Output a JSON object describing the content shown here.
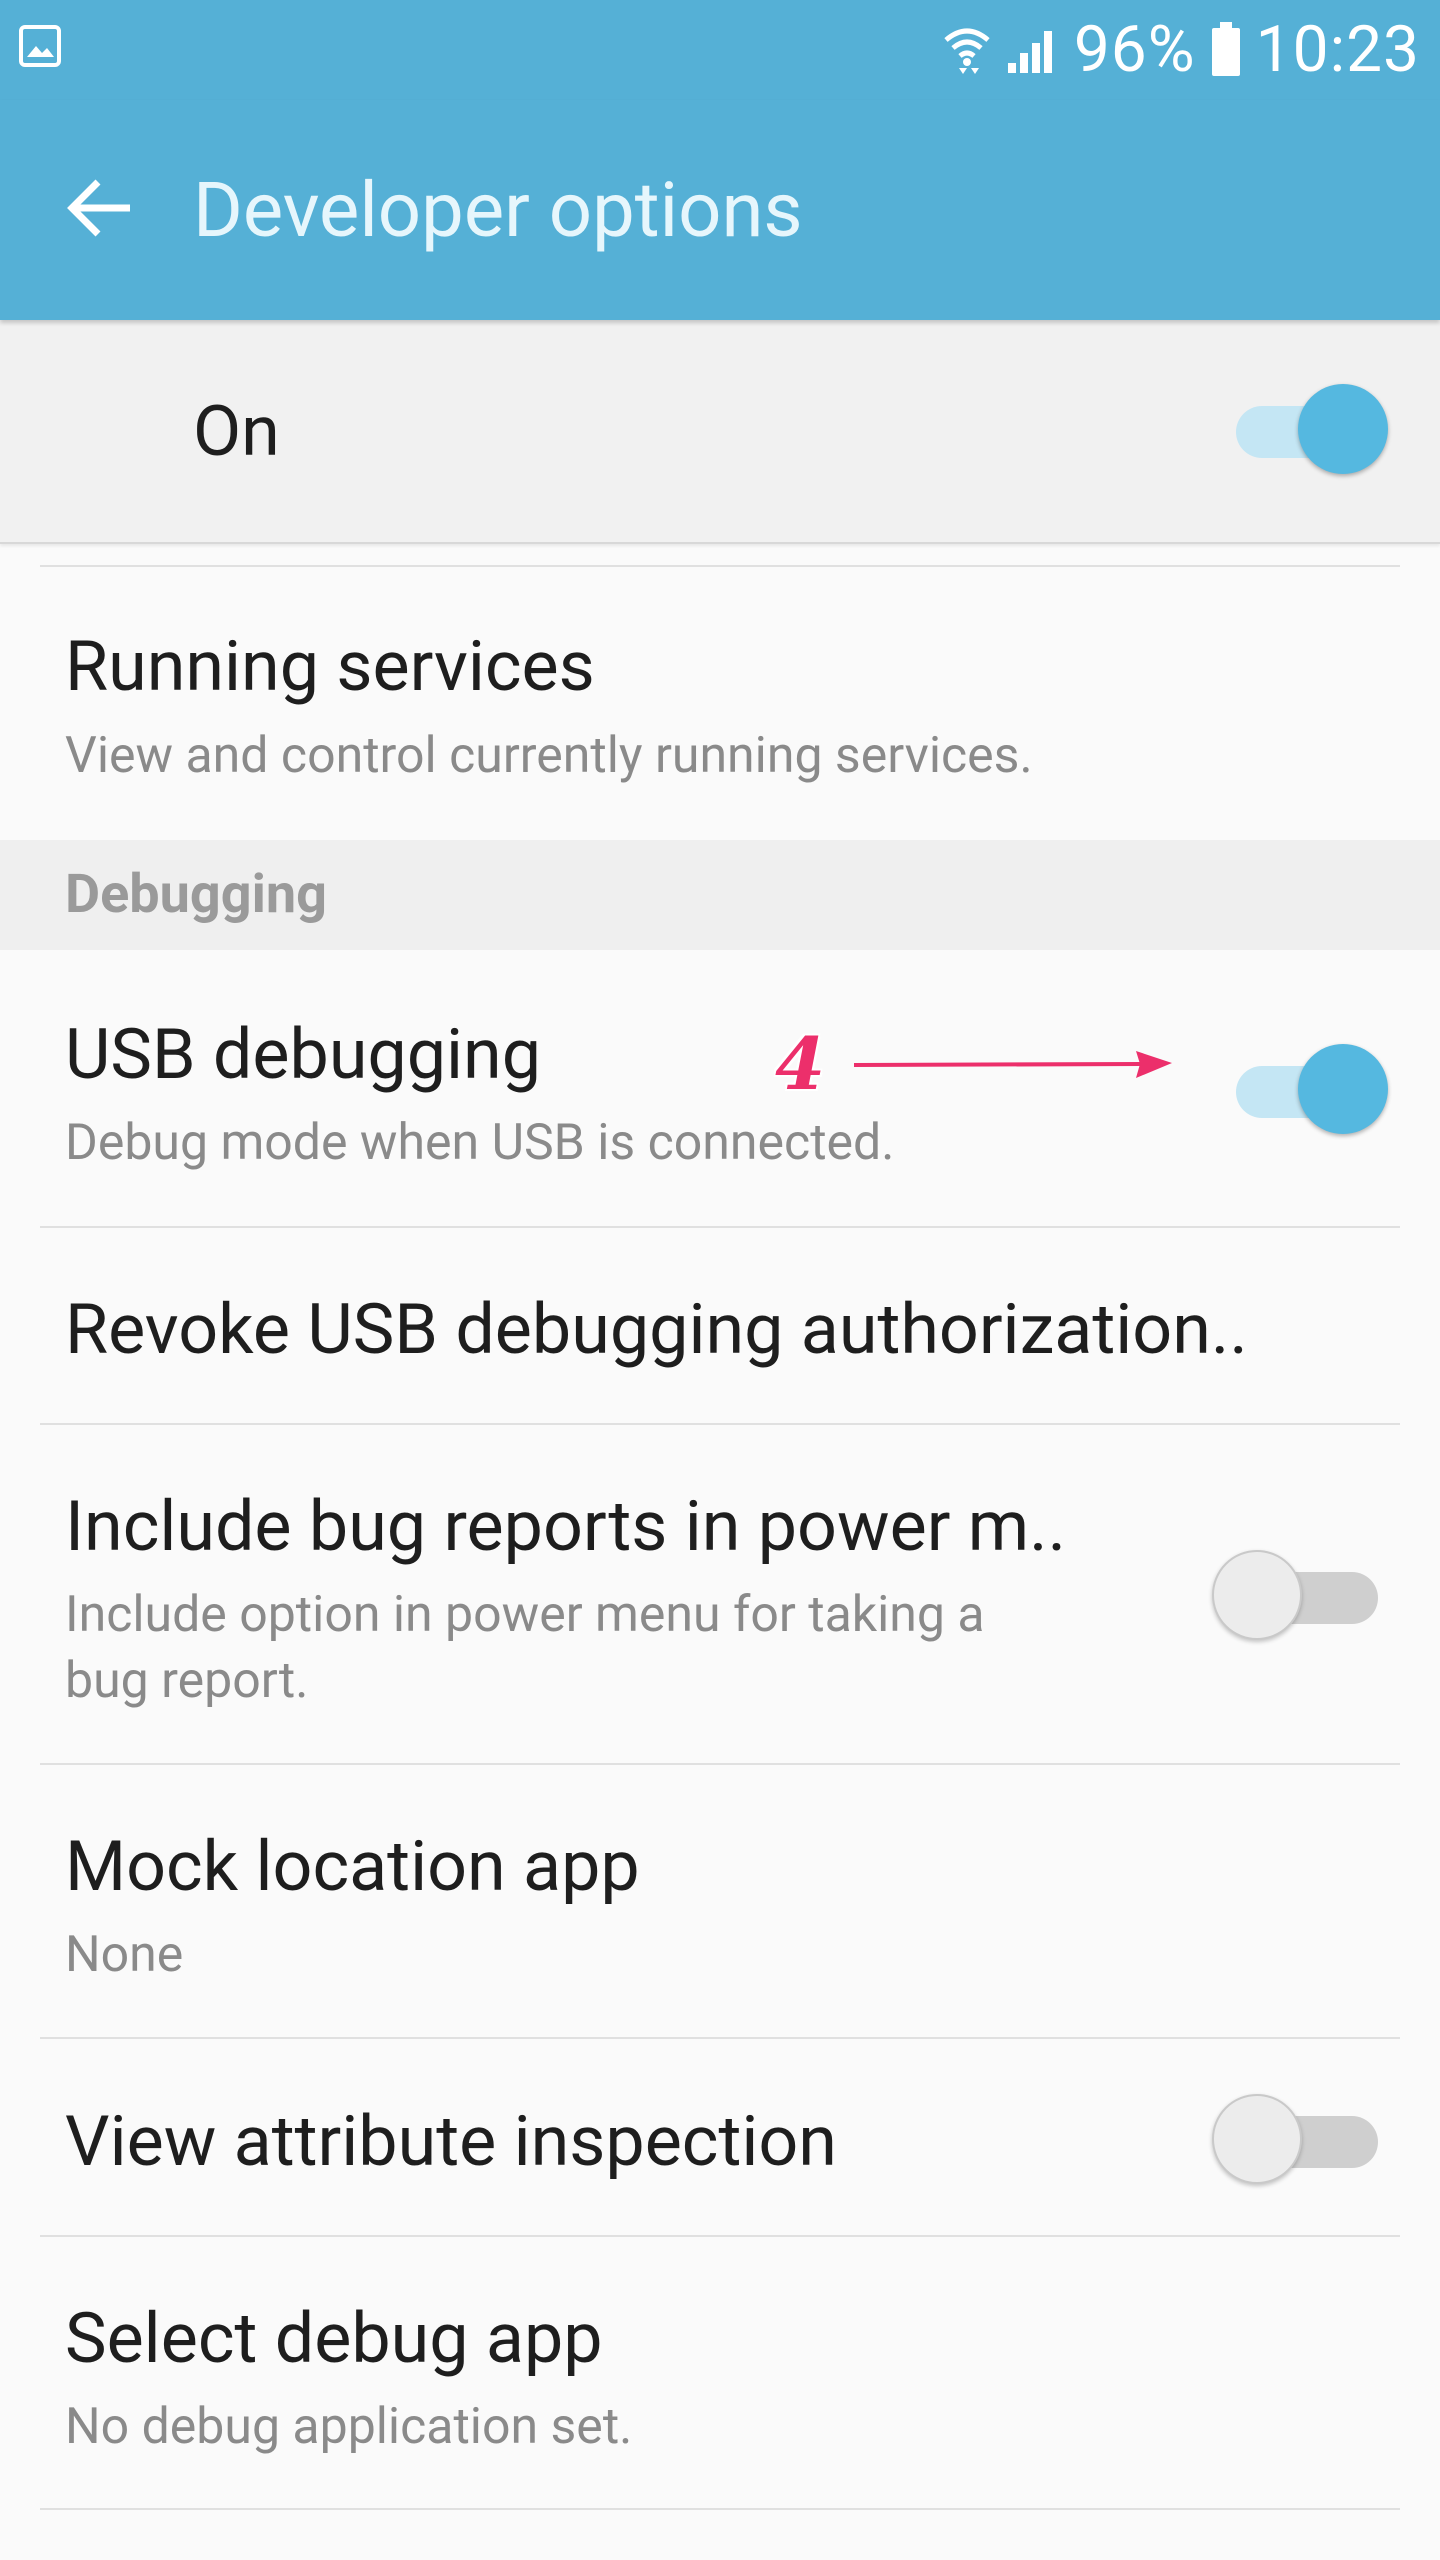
{
  "status_bar": {
    "battery_text": "96%",
    "time": "10:23",
    "icons": [
      "gallery-icon",
      "wifi-icon",
      "signal-icon",
      "battery-icon"
    ]
  },
  "app_bar": {
    "title": "Developer options",
    "back_icon": "back-arrow-icon"
  },
  "master_switch": {
    "label": "On",
    "state": true
  },
  "items": [
    {
      "title": "Running services",
      "subtitle": "View and control currently running services."
    }
  ],
  "debugging": {
    "header": "Debugging",
    "items": [
      {
        "title": "USB debugging",
        "subtitle": "Debug mode when USB is connected.",
        "switch_on": true
      },
      {
        "title": "Revoke USB debugging authorization.."
      },
      {
        "title": "Include bug reports in power m..",
        "subtitle_line1": "Include option in power menu for taking a",
        "subtitle_line2": "bug report.",
        "switch_on": false
      },
      {
        "title": "Mock location app",
        "subtitle": "None"
      },
      {
        "title": "View attribute inspection",
        "switch_on": false
      },
      {
        "title": "Select debug app",
        "subtitle": "No debug application set."
      }
    ]
  },
  "annotation": {
    "number": "4",
    "color": "#ec2f6b"
  },
  "colors": {
    "primary": "#55b0d6",
    "switch_on": "#55b8e0",
    "switch_track_on": "#c4e6f4"
  }
}
